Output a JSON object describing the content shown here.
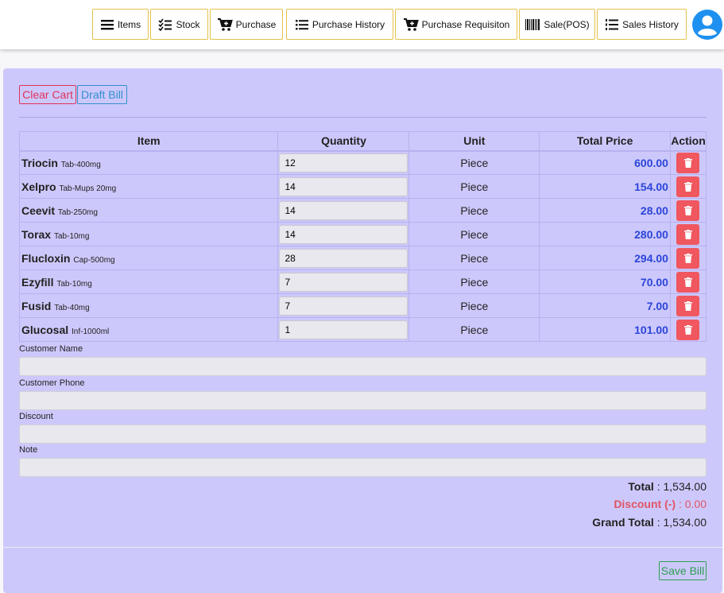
{
  "nav": {
    "items_label": "Items",
    "stock_label": "Stock",
    "purchase_label": "Purchase",
    "purchase_history_label": "Purchase History",
    "purchase_requisition_label": "Purchase Requisiton",
    "sale_pos_label": "Sale(POS)",
    "sales_history_label": "Sales History",
    "avatar_icon": "user-circle-icon"
  },
  "cart": {
    "clear_cart_label": "Clear Cart",
    "draft_bill_label": "Draft Bill",
    "columns": [
      "Item",
      "Quantity",
      "Unit",
      "Total Price",
      "Action"
    ],
    "rows": [
      {
        "name": "Triocin",
        "meta": "Tab-400mg",
        "qty": "12",
        "unit": "Piece",
        "price": "600.00"
      },
      {
        "name": "Xelpro",
        "meta": "Tab-Mups 20mg",
        "qty": "14",
        "unit": "Piece",
        "price": "154.00"
      },
      {
        "name": "Ceevit",
        "meta": "Tab-250mg",
        "qty": "14",
        "unit": "Piece",
        "price": "28.00"
      },
      {
        "name": "Torax",
        "meta": "Tab-10mg",
        "qty": "14",
        "unit": "Piece",
        "price": "280.00"
      },
      {
        "name": "Flucloxin",
        "meta": "Cap-500mg",
        "qty": "28",
        "unit": "Piece",
        "price": "294.00"
      },
      {
        "name": "Ezyfill",
        "meta": "Tab-10mg",
        "qty": "7",
        "unit": "Piece",
        "price": "70.00"
      },
      {
        "name": "Fusid",
        "meta": "Tab-40mg",
        "qty": "7",
        "unit": "Piece",
        "price": "7.00"
      },
      {
        "name": "Glucosal",
        "meta": "Inf-1000ml",
        "qty": "1",
        "unit": "Piece",
        "price": "101.00"
      }
    ]
  },
  "form": {
    "customer_name_label": "Customer Name",
    "customer_name_value": "",
    "customer_phone_label": "Customer Phone",
    "customer_phone_value": "",
    "discount_label": "Discount",
    "discount_value": "",
    "note_label": "Note",
    "note_value": ""
  },
  "totals": {
    "total_label": "Total",
    "total_value": "1,534.00",
    "discount_label": "Discount (-)",
    "discount_value": "0.00",
    "grand_total_label": "Grand Total",
    "grand_total_value": "1,534.00"
  },
  "save_bill_label": "Save Bill",
  "colors": {
    "panel_bg": "#cdc8fb",
    "nav_border": "#e3c24a",
    "price_text": "#2b45d8",
    "delete_button": "#f0575f",
    "clear_cart": "#e0335b",
    "draft_bill": "#2f8fd0",
    "save_bill": "#2f9e52",
    "avatar": "#1e90ef"
  }
}
